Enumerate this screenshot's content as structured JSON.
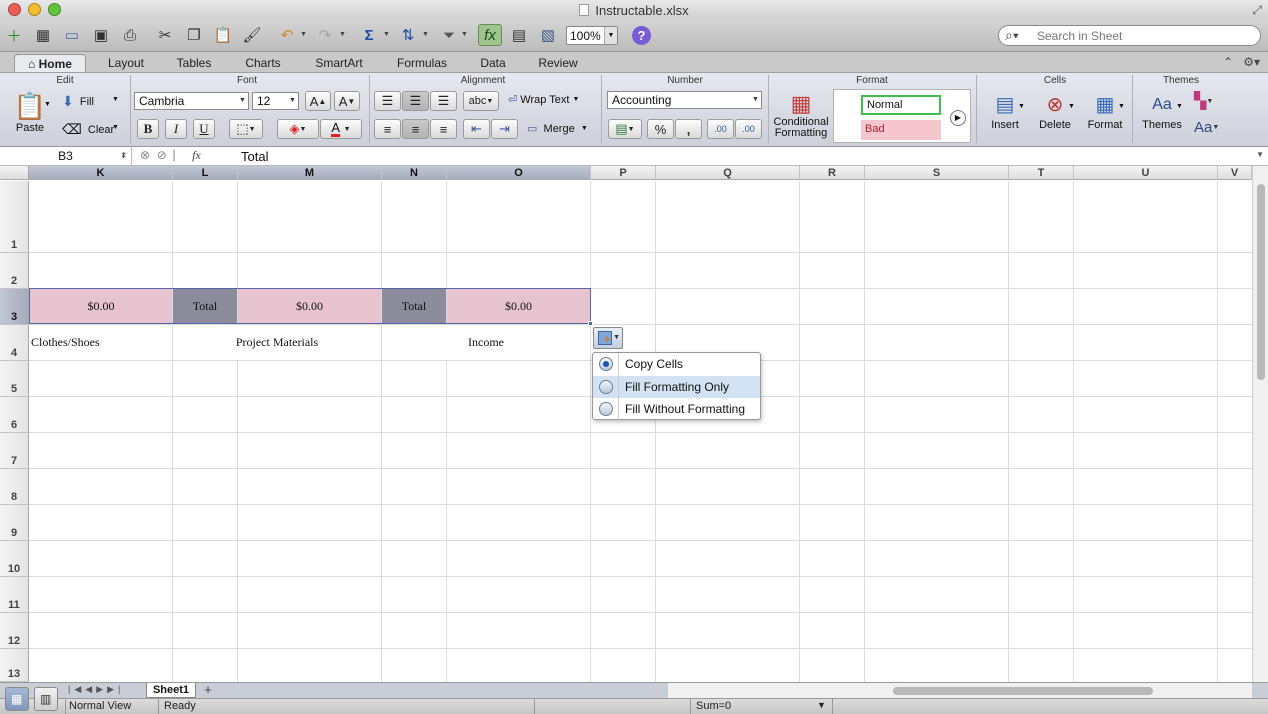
{
  "window": {
    "title": "Instructable.xlsx"
  },
  "toolbar": {
    "zoom": "100%",
    "help_label": "?",
    "search_placeholder": "Search in Sheet",
    "fx_label": "fx"
  },
  "ribbon_tabs": [
    "Home",
    "Layout",
    "Tables",
    "Charts",
    "SmartArt",
    "Formulas",
    "Data",
    "Review"
  ],
  "ribbon": {
    "groups": {
      "edit": "Edit",
      "font": "Font",
      "alignment": "Alignment",
      "number": "Number",
      "format": "Format",
      "cells": "Cells",
      "themes": "Themes"
    },
    "paste": "Paste",
    "fill": "Fill",
    "clear": "Clear",
    "font_name": "Cambria",
    "font_size": "12",
    "bold": "B",
    "italic": "I",
    "underline": "U",
    "font_grow": "A",
    "font_shrink": "A",
    "font_color_letter": "A",
    "abc": "abc",
    "wrap_text": "Wrap Text",
    "merge": "Merge",
    "number_format": "Accounting",
    "percent": "%",
    "comma": ",",
    "inc_decimal": ".00",
    "dec_decimal": ".00",
    "conditional_formatting_line1": "Conditional",
    "conditional_formatting_line2": "Formatting",
    "style_normal": "Normal",
    "style_bad": "Bad",
    "insert": "Insert",
    "delete": "Delete",
    "format": "Format",
    "themes": "Themes",
    "theme_fonts": "Aa"
  },
  "formula_bar": {
    "name_box": "B3",
    "formula": "Total"
  },
  "columns": [
    "K",
    "L",
    "M",
    "N",
    "O",
    "P",
    "Q",
    "R",
    "S",
    "T",
    "U",
    "V"
  ],
  "rows": [
    "1",
    "2",
    "3",
    "4",
    "5",
    "6",
    "7",
    "8",
    "9",
    "10",
    "11",
    "12",
    "13"
  ],
  "cells": {
    "K3": "$0.00",
    "L3": "Total",
    "M3": "$0.00",
    "N3": "Total",
    "O3": "$0.00",
    "K4": "Clothes/Shoes",
    "M4": "Project Materials",
    "O4": "Income"
  },
  "autofill_menu": {
    "items": [
      "Copy Cells",
      "Fill Formatting Only",
      "Fill Without Formatting"
    ],
    "selected": "Copy Cells",
    "highlighted": "Fill Formatting Only"
  },
  "sheet_tabs": [
    "Sheet1"
  ],
  "add_sheet": "+",
  "status": {
    "view": "Normal View",
    "state": "Ready",
    "sum": "Sum=0"
  },
  "colors": {
    "accent_fill": "#e6c3ce",
    "total_fill": "#8c8c9c",
    "selection": "#5466a8"
  }
}
